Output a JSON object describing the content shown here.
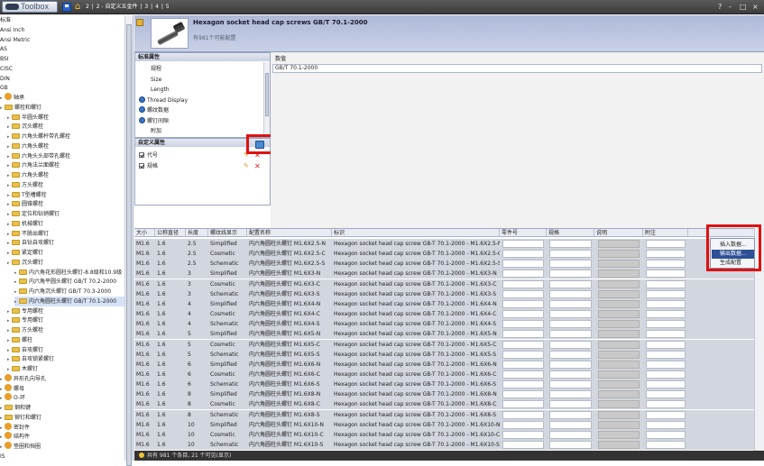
{
  "app": {
    "title": "Toolbox",
    "breadcrumb": [
      "2",
      "|",
      "2 - 自定义五金件",
      "|",
      "3",
      "|",
      "4",
      "|",
      "5"
    ],
    "controls": [
      "?",
      "-",
      "□",
      "×"
    ]
  },
  "sidebar": {
    "items": [
      {
        "label": "标准",
        "level": 0,
        "icon": "none"
      },
      {
        "label": "Ansi Inch",
        "level": 0,
        "icon": "none"
      },
      {
        "label": "Ansi Metric",
        "level": 0,
        "icon": "none"
      },
      {
        "label": "AS",
        "level": 0,
        "icon": "none"
      },
      {
        "label": "BSI",
        "level": 0,
        "icon": "none"
      },
      {
        "label": "CISC",
        "level": 0,
        "icon": "none"
      },
      {
        "label": "DIN",
        "level": 0,
        "icon": "none"
      },
      {
        "label": "GB",
        "level": 0,
        "icon": "none"
      },
      {
        "label": "轴承",
        "level": 0,
        "icon": "gear"
      },
      {
        "label": "螺栓和螺钉",
        "level": 0,
        "icon": "folder"
      },
      {
        "label": "半圆头螺栓",
        "level": 1,
        "icon": "folder"
      },
      {
        "label": "沉头螺栓",
        "level": 1,
        "icon": "folder"
      },
      {
        "label": "六角头螺杆带孔螺栓",
        "level": 1,
        "icon": "folder"
      },
      {
        "label": "六角头螺栓",
        "level": 1,
        "icon": "folder"
      },
      {
        "label": "六角头头部带孔螺栓",
        "level": 1,
        "icon": "folder"
      },
      {
        "label": "六角法兰面螺栓",
        "level": 1,
        "icon": "folder"
      },
      {
        "label": "六角头螺栓",
        "level": 1,
        "icon": "folder"
      },
      {
        "label": "方头螺栓",
        "level": 1,
        "icon": "folder"
      },
      {
        "label": "T型槽螺栓",
        "level": 1,
        "icon": "folder"
      },
      {
        "label": "圆锥螺栓",
        "level": 1,
        "icon": "folder"
      },
      {
        "label": "定位和钻销螺钉",
        "level": 1,
        "icon": "folder"
      },
      {
        "label": "机械螺钉",
        "level": 1,
        "icon": "folder"
      },
      {
        "label": "不脱出螺钉",
        "level": 1,
        "icon": "folder"
      },
      {
        "label": "自钻自攻螺钉",
        "level": 1,
        "icon": "folder"
      },
      {
        "label": "紧定螺钉",
        "level": 1,
        "icon": "folder"
      },
      {
        "label": "沉头螺钉",
        "level": 1,
        "icon": "folder"
      },
      {
        "label": "内六角花形圆柱头螺钉-8.8级和10.9级",
        "level": 2,
        "icon": "folder"
      },
      {
        "label": "内六角平圆头螺钉 GB/T 70.2-2000",
        "level": 2,
        "icon": "folder"
      },
      {
        "label": "内六角沉头螺钉 GB/T 70.3-2000",
        "level": 2,
        "icon": "folder"
      },
      {
        "label": "内六角圆柱头螺钉 GB/T 70.1-2000",
        "level": 2,
        "icon": "folder",
        "selected": true
      },
      {
        "label": "专用螺栓",
        "level": 1,
        "icon": "folder"
      },
      {
        "label": "专用螺钉",
        "level": 1,
        "icon": "folder"
      },
      {
        "label": "方头螺栓",
        "level": 1,
        "icon": "folder"
      },
      {
        "label": "螺柱",
        "level": 1,
        "icon": "folder"
      },
      {
        "label": "自攻螺钉",
        "level": 1,
        "icon": "folder"
      },
      {
        "label": "自攻锁紧螺钉",
        "level": 1,
        "icon": "folder"
      },
      {
        "label": "木螺钉",
        "level": 1,
        "icon": "folder"
      },
      {
        "label": "异形孔向导孔",
        "level": 0,
        "icon": "gear"
      },
      {
        "label": "螺母",
        "level": 0,
        "icon": "gear"
      },
      {
        "label": "O-环",
        "level": 0,
        "icon": "gear"
      },
      {
        "label": "钢和键",
        "level": 0,
        "icon": "folder"
      },
      {
        "label": "铆钉和螺钉",
        "level": 0,
        "icon": "folder"
      },
      {
        "label": "密封件",
        "level": 0,
        "icon": "gear"
      },
      {
        "label": "结构件",
        "level": 0,
        "icon": "gear"
      },
      {
        "label": "垫圈和挡圈",
        "level": 0,
        "icon": "gear"
      },
      {
        "label": "IS",
        "level": 0,
        "icon": "none"
      }
    ]
  },
  "header": {
    "title": "Hexagon socket head cap screws GB/T 70.1-2000",
    "subtitle": "有981个可能配置"
  },
  "props": {
    "header": "标准属性",
    "items": [
      {
        "label": "规程",
        "icon": "none"
      },
      {
        "label": "Size",
        "icon": "none"
      },
      {
        "label": "Length",
        "icon": "none"
      },
      {
        "label": "Thread Display",
        "icon": "globe"
      },
      {
        "label": "螺纹数据",
        "icon": "globe"
      },
      {
        "label": "螺钉间隙",
        "icon": "globe"
      },
      {
        "label": "附加",
        "icon": "none"
      }
    ]
  },
  "custom": {
    "header": "自定义属性",
    "items": [
      {
        "label": "代号"
      },
      {
        "label": "规格"
      }
    ]
  },
  "value": {
    "label": "数值",
    "text": "GB/T 70.1-2000"
  },
  "table": {
    "columns": [
      "大小",
      "公称直径",
      "长度",
      "螺纹线显示",
      "配置名称",
      "标识",
      "零件号",
      "规格",
      "说明",
      "附注"
    ],
    "rows": [
      [
        "M1.6",
        "1.6",
        "2.5",
        "Simplified",
        "内六角圆柱头螺钉 M1.6X2.5-N",
        "Hexagon socket head cap screw GB-T 70.1-2000 - M1.6X2.5-N"
      ],
      [
        "M1.6",
        "1.6",
        "2.5",
        "Cosmetic",
        "内六角圆柱头螺钉 M1.6X2.5-C",
        "Hexagon socket head cap screw GB-T 70.1-2000 - M1.6X2.5-C"
      ],
      [
        "M1.6",
        "1.6",
        "2.5",
        "Schematic",
        "内六角圆柱头螺钉 M1.6X2.5-S",
        "Hexagon socket head cap screw GB-T 70.1-2000 - M1.6X2.5-S"
      ],
      [
        "M1.6",
        "1.6",
        "3",
        "Simplified",
        "内六角圆柱头螺钉 M1.6X3-N",
        "Hexagon socket head cap screw GB-T 70.1-2000 - M1.6X3-N"
      ],
      [
        "M1.6",
        "1.6",
        "3",
        "Cosmetic",
        "内六角圆柱头螺钉 M1.6X3-C",
        "Hexagon socket head cap screw GB-T 70.1-2000 - M1.6X3-C"
      ],
      [
        "M1.6",
        "1.6",
        "3",
        "Schematic",
        "内六角圆柱头螺钉 M1.6X3-S",
        "Hexagon socket head cap screw GB-T 70.1-2000 - M1.6X3-S"
      ],
      [
        "M1.6",
        "1.6",
        "4",
        "Simplified",
        "内六角圆柱头螺钉 M1.6X4-N",
        "Hexagon socket head cap screw GB-T 70.1-2000 - M1.6X4-N"
      ],
      [
        "M1.6",
        "1.6",
        "4",
        "Cosmetic",
        "内六角圆柱头螺钉 M1.6X4-C",
        "Hexagon socket head cap screw GB-T 70.1-2000 - M1.6X4-C"
      ],
      [
        "M1.6",
        "1.6",
        "4",
        "Schematic",
        "内六角圆柱头螺钉 M1.6X4-S",
        "Hexagon socket head cap screw GB-T 70.1-2000 - M1.6X4-S"
      ],
      [
        "M1.6",
        "1.6",
        "5",
        "Simplified",
        "内六角圆柱头螺钉 M1.6X5-N",
        "Hexagon socket head cap screw GB-T 70.1-2000 - M1.6X5-N"
      ],
      [
        "M1.6",
        "1.6",
        "5",
        "Cosmetic",
        "内六角圆柱头螺钉 M1.6X5-C",
        "Hexagon socket head cap screw GB-T 70.1-2000 - M1.6X5-C"
      ],
      [
        "M1.6",
        "1.6",
        "5",
        "Schematic",
        "内六角圆柱头螺钉 M1.6X5-S",
        "Hexagon socket head cap screw GB-T 70.1-2000 - M1.6X5-S"
      ],
      [
        "M1.6",
        "1.6",
        "6",
        "Simplified",
        "内六角圆柱头螺钉 M1.6X6-N",
        "Hexagon socket head cap screw GB-T 70.1-2000 - M1.6X6-N"
      ],
      [
        "M1.6",
        "1.6",
        "6",
        "Cosmetic",
        "内六角圆柱头螺钉 M1.6X6-C",
        "Hexagon socket head cap screw GB-T 70.1-2000 - M1.6X6-C"
      ],
      [
        "M1.6",
        "1.6",
        "6",
        "Schematic",
        "内六角圆柱头螺钉 M1.6X6-S",
        "Hexagon socket head cap screw GB-T 70.1-2000 - M1.6X6-S"
      ],
      [
        "M1.6",
        "1.6",
        "8",
        "Simplified",
        "内六角圆柱头螺钉 M1.6X8-N",
        "Hexagon socket head cap screw GB-T 70.1-2000 - M1.6X8-N"
      ],
      [
        "M1.6",
        "1.6",
        "8",
        "Cosmetic",
        "内六角圆柱头螺钉 M1.6X8-C",
        "Hexagon socket head cap screw GB-T 70.1-2000 - M1.6X8-C"
      ],
      [
        "M1.6",
        "1.6",
        "8",
        "Schematic",
        "内六角圆柱头螺钉 M1.6X8-S",
        "Hexagon socket head cap screw GB-T 70.1-2000 - M1.6X8-S"
      ],
      [
        "M1.6",
        "1.6",
        "10",
        "Simplified",
        "内六角圆柱头螺钉 M1.6X10-N",
        "Hexagon socket head cap screw GB-T 70.1-2000 - M1.6X10-N"
      ],
      [
        "M1.6",
        "1.6",
        "10",
        "Cosmetic",
        "内六角圆柱头螺钉 M1.6X10-C",
        "Hexagon socket head cap screw GB-T 70.1-2000 - M1.6X10-C"
      ],
      [
        "M1.6",
        "1.6",
        "10",
        "Schematic",
        "内六角圆柱头螺钉 M1.6X10-S",
        "Hexagon socket head cap screw GB-T 70.1-2000 - M1.6X10-S"
      ]
    ]
  },
  "context_menu": {
    "items": [
      "插入数据...",
      "输出数据...",
      "生成配置"
    ],
    "highlighted": 1
  },
  "status": {
    "text": "共有 981 个条目, 21 个可见(显示)"
  },
  "colors": {
    "highlight_box": "#e01010",
    "menu_highlight": "#2c4f95",
    "header_bg": "#b8c2de"
  },
  "icons": {
    "save": "save-icon",
    "home": "home-icon",
    "part": "part-icon",
    "excel": "excel-icon",
    "edit": "pencil-icon",
    "delete": "delete-icon"
  }
}
